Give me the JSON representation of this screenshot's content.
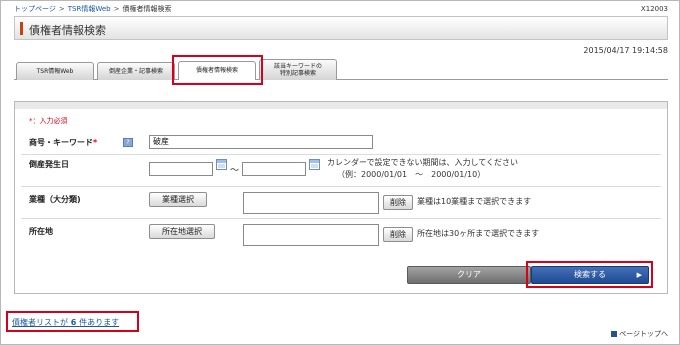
{
  "breadcrumb": [
    "トップページ",
    "TSR情報Web",
    "債権者情報検索"
  ],
  "screen_code": "X12003",
  "page_title": "債権者情報検索",
  "datetime": "2015/04/17 19:14:58",
  "tabs": [
    {
      "label": "TSR情報Web",
      "active": false
    },
    {
      "label": "倒産企業・記事検索",
      "active": false
    },
    {
      "label": "債権者情報検索",
      "active": true
    },
    {
      "label_line1": "該当キーワードの",
      "label_line2": "特別記事検索",
      "active": false
    }
  ],
  "form": {
    "required_note": "*：入力必須",
    "keyword": {
      "label": "商号・キーワード",
      "required_mark": "*",
      "help_icon": "?",
      "value": "破産"
    },
    "date": {
      "label": "倒産発生日",
      "separator": "～",
      "note_line1": "カレンダーで設定できない期間は、入力してください",
      "note_line2": "（例：2000/01/01　～　2000/01/10）"
    },
    "industry": {
      "label": "業種（大分類)",
      "select_button": "業種選択",
      "delete_button": "削除",
      "note": "業種は10業種まで選択できます"
    },
    "location": {
      "label": "所在地",
      "select_button": "所在地選択",
      "delete_button": "削除",
      "note": "所在地は30ヶ所まで選択できます"
    },
    "clear_button": "クリア",
    "search_button": "検索する"
  },
  "result_link": {
    "prefix": "債権者リストが",
    "count": "6",
    "suffix": "件あります"
  },
  "page_top": "ページトップへ"
}
